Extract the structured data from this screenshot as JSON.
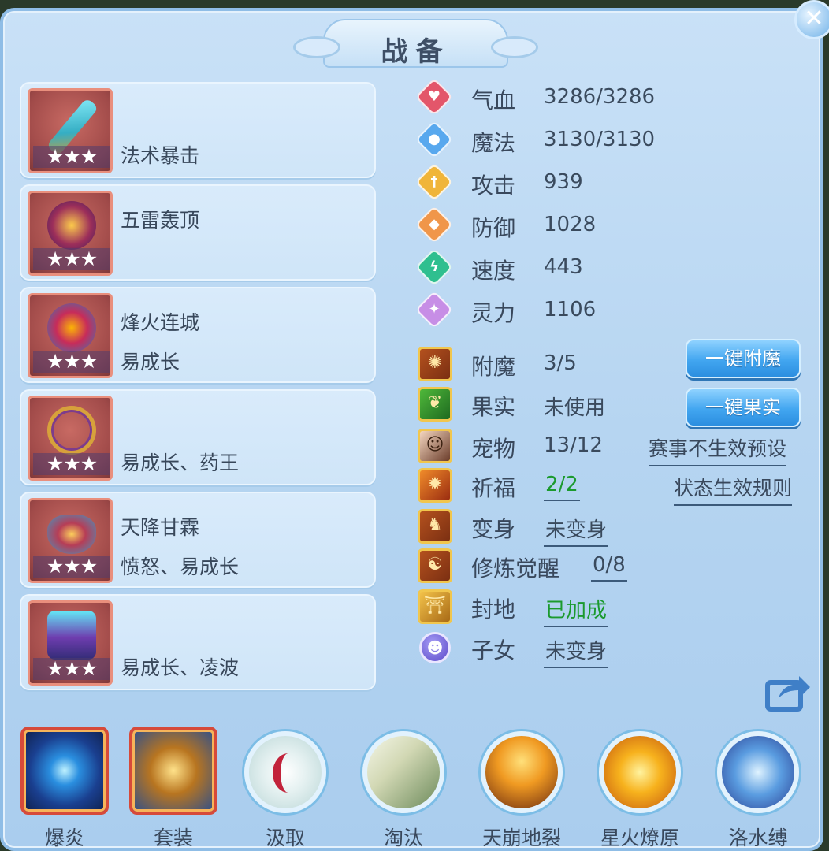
{
  "title": "战备",
  "close_icon": "close-icon",
  "equipment": [
    {
      "line1": "",
      "line2": "法术暴击",
      "stars": "★★★",
      "icon": "sword-icon"
    },
    {
      "line1": "五雷轰顶",
      "line2": "",
      "stars": "★★★",
      "icon": "helmet-icon"
    },
    {
      "line1": "烽火连城",
      "line2": "易成长",
      "stars": "★★★",
      "icon": "amulet-icon"
    },
    {
      "line1": "",
      "line2": "易成长、药王",
      "stars": "★★★",
      "icon": "necklace-icon"
    },
    {
      "line1": "天降甘霖",
      "line2": "愤怒、易成长",
      "stars": "★★★",
      "icon": "belt-icon"
    },
    {
      "line1": "",
      "line2": "易成长、凌波",
      "stars": "★★★",
      "icon": "boots-icon"
    }
  ],
  "stats": [
    {
      "label": "气血",
      "value": "3286/3286",
      "icon": "heart-icon",
      "color": "#e3566a"
    },
    {
      "label": "魔法",
      "value": "3130/3130",
      "icon": "mana-icon",
      "color": "#58a8ee"
    },
    {
      "label": "攻击",
      "value": "939",
      "icon": "sword-stat-icon",
      "color": "#f0b53a"
    },
    {
      "label": "防御",
      "value": "1028",
      "icon": "shield-icon",
      "color": "#f0964a"
    },
    {
      "label": "速度",
      "value": "443",
      "icon": "speed-icon",
      "color": "#2fbf8f"
    },
    {
      "label": "灵力",
      "value": "1106",
      "icon": "spirit-icon",
      "color": "#c78ee6"
    }
  ],
  "extras": [
    {
      "label": "附魔",
      "value": "3/5",
      "icon": "enchant-icon"
    },
    {
      "label": "果实",
      "value": "未使用",
      "icon": "fruit-icon"
    },
    {
      "label": "宠物",
      "value": "13/12",
      "icon": "pet-avatar-icon"
    },
    {
      "label": "祈福",
      "value": "2/2",
      "icon": "blessing-icon"
    },
    {
      "label": "变身",
      "value": "未变身",
      "icon": "transform-icon"
    },
    {
      "label": "修炼觉醒",
      "value": "0/8",
      "icon": "cultivation-icon"
    },
    {
      "label": "封地",
      "value": "已加成",
      "icon": "fief-icon"
    },
    {
      "label": "子女",
      "value": "未变身",
      "icon": "children-icon"
    }
  ],
  "buttons": {
    "enchant_all": "一键附魔",
    "fruit_all": "一键果实",
    "match_preset": "赛事不生效预设",
    "status_rules": "状态生效规则"
  },
  "share_icon": "share-icon",
  "skills": [
    {
      "label": "爆炎",
      "icon": "blast-flame-icon"
    },
    {
      "label": "套装",
      "icon": "suit-icon"
    },
    {
      "label": "汲取",
      "icon": "absorb-icon"
    },
    {
      "label": "淘汰",
      "icon": "eliminate-icon"
    },
    {
      "label": "天崩地裂",
      "icon": "earthquake-icon"
    },
    {
      "label": "星火燎原",
      "icon": "spark-fire-icon"
    },
    {
      "label": "洛水缚",
      "icon": "water-bind-icon"
    }
  ]
}
